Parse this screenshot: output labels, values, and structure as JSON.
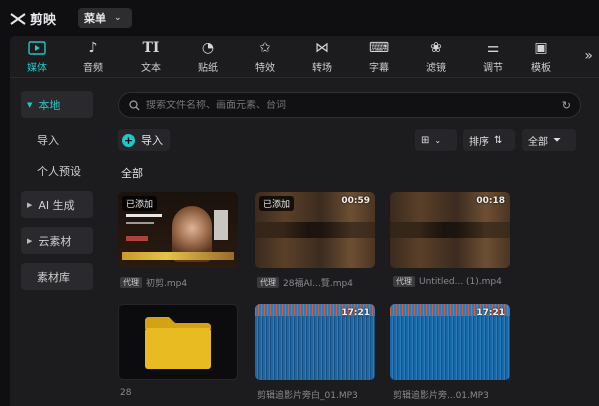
{
  "app": {
    "name": "剪映",
    "menu_label": "菜单"
  },
  "toolbar": {
    "tools": [
      {
        "label": "媒体",
        "icon": "media-icon"
      },
      {
        "label": "音频",
        "icon": "audio-icon"
      },
      {
        "label": "文本",
        "icon": "text-icon"
      },
      {
        "label": "贴纸",
        "icon": "sticker-icon"
      },
      {
        "label": "特效",
        "icon": "effects-icon"
      },
      {
        "label": "转场",
        "icon": "transition-icon"
      },
      {
        "label": "字幕",
        "icon": "subtitle-icon"
      },
      {
        "label": "滤镜",
        "icon": "filter-icon"
      },
      {
        "label": "调节",
        "icon": "adjust-icon"
      },
      {
        "label": "模板",
        "icon": "template-icon"
      }
    ],
    "active": "媒体",
    "more_icon": "double-chevron-right-icon",
    "accent": "#1fc7c7"
  },
  "sidebar": {
    "local": "本地",
    "import": "导入",
    "personal_presets": "个人预设",
    "ai_generate": "AI 生成",
    "cloud_assets": "云素材",
    "asset_library": "素材库"
  },
  "search": {
    "placeholder": "搜索文件名称、画面元素、台词"
  },
  "actions": {
    "import": "导入",
    "sort": "排序",
    "all": "全部"
  },
  "section_title": "全部",
  "media": [
    {
      "badge": "已添加",
      "duration": "",
      "tag": "代理",
      "name": "初剪.mp4"
    },
    {
      "badge": "已添加",
      "duration": "00:59",
      "tag": "代理",
      "name": "28福AI...覽.mp4"
    },
    {
      "badge": "",
      "duration": "00:18",
      "tag": "代理",
      "name": "Untitled... (1).mp4"
    },
    {
      "badge": "",
      "duration": "",
      "tag": "",
      "name": "28"
    },
    {
      "badge": "",
      "duration": "17:21",
      "tag": "",
      "name": "剪辑追影片旁白_01.MP3"
    },
    {
      "badge": "",
      "duration": "17:21",
      "tag": "",
      "name": "剪辑追影片旁...01.MP3"
    }
  ]
}
